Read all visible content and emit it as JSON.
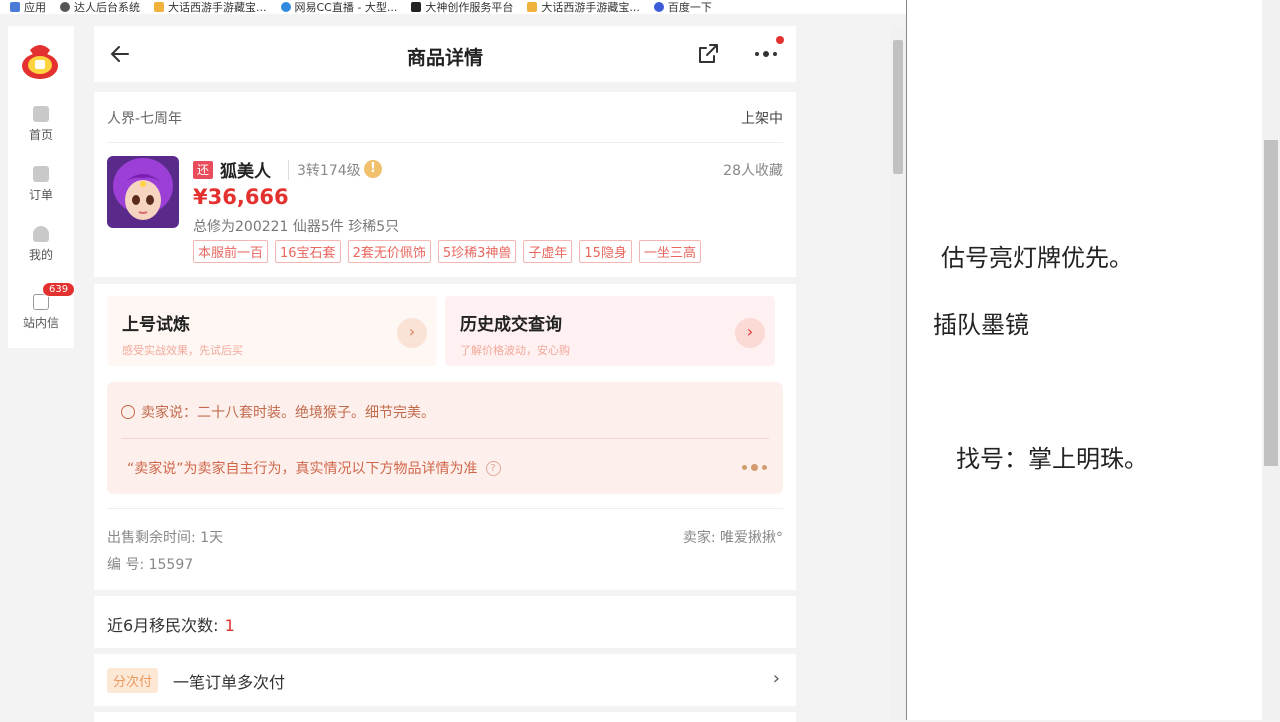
{
  "bookmarks": [
    {
      "label": "应用",
      "icon": "apps-grid-icon",
      "color": "#4a7bd8"
    },
    {
      "label": "达人后台系统",
      "icon": "globe-icon",
      "color": "#555555"
    },
    {
      "label": "大话西游手游藏宝...",
      "icon": "game-icon",
      "color": "#f0b23a"
    },
    {
      "label": "网易CC直播 - 大型...",
      "icon": "cc-icon",
      "color": "#2f8be0"
    },
    {
      "label": "大神创作服务平台",
      "icon": "dashen-icon",
      "color": "#222222"
    },
    {
      "label": "大话西游手游藏宝...",
      "icon": "game-icon",
      "color": "#f0b23a"
    },
    {
      "label": "百度一下",
      "icon": "baidu-icon",
      "color": "#3b5bd8"
    }
  ],
  "leftnav": {
    "items": [
      {
        "label": "首页",
        "icon": "home-icon"
      },
      {
        "label": "订单",
        "icon": "order-icon"
      },
      {
        "label": "我的",
        "icon": "user-icon"
      },
      {
        "label": "站内信",
        "icon": "mail-icon",
        "badge": "639"
      }
    ]
  },
  "header": {
    "title": "商品详情"
  },
  "item": {
    "server": "人界-七周年",
    "status": "上架中",
    "re_tag": "还",
    "name": "狐美人",
    "level": "3转174级",
    "favorites": "28人收藏",
    "price": "¥36,666",
    "attrs": "总修为200221  仙器5件  珍稀5只",
    "tags": [
      "本服前一百",
      "16宝石套",
      "2套无价佩饰",
      "5珍稀3神兽",
      "子虚年",
      "15隐身",
      "一坐三高"
    ]
  },
  "tools": {
    "trial": {
      "title": "上号试炼",
      "subtitle": "感受实战效果，先试后买"
    },
    "history": {
      "title": "历史成交查询",
      "subtitle": "了解价格波动，安心购"
    }
  },
  "seller_say": {
    "text": "卖家说：二十八套时装。绝境猴子。细节完美。",
    "disclaimer": "“卖家说”为卖家自主行为，真实情况以下方物品详情为准"
  },
  "meta": {
    "remain": "出售剩余时间: 1天",
    "seller": "卖家: 唯爱揪揪°",
    "serial": "编 号: 15597"
  },
  "migrate": {
    "label": "近6月移民次数:",
    "count": "1"
  },
  "installment": {
    "tag": "分次付",
    "text": "一笔订单多次付"
  },
  "notes": [
    {
      "text": "估号亮灯牌优先。"
    },
    {
      "text": "插队墨镜"
    },
    {
      "text": "找号：掌上明珠。"
    }
  ],
  "colors": {
    "accent": "#e2312f",
    "tag_border": "#f3b7b3",
    "seller_bg": "#fdf0ec"
  }
}
